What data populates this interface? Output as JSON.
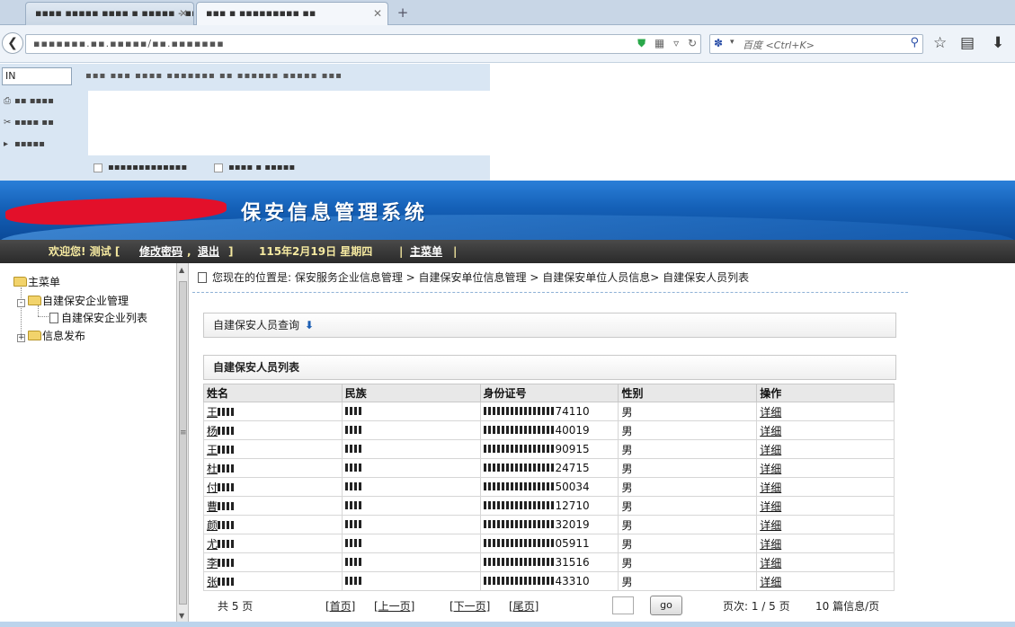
{
  "browser": {
    "tabs": [
      {
        "label": "▪▪▪▪ ▪▪▪▪▪ ▪▪▪▪ ▪ ▪▪▪▪▪ - ▪▪▪▪",
        "state": "inactive"
      },
      {
        "label": "▪▪▪ ▪ ▪▪▪▪▪▪▪▪▪ ▪▪",
        "state": "active"
      }
    ],
    "tab_close": "✕",
    "new_tab": "+",
    "url": "▪▪▪▪▪▪▪.▪▪.▪▪▪▪▪/▪▪.▪▪▪▪▪▪▪",
    "search_placeholder": "百度 <Ctrl+K>"
  },
  "extbar": {
    "input_value": "IN",
    "blur_text": "▪▪▪ ▪▪▪ ▪▪▪▪ ▪▪▪▪▪▪▪ ▪▪ ▪▪▪▪▪▪ ▪▪▪▪▪ ▪▪▪",
    "panel_items": [
      "▪▪ ▪▪▪▪",
      "▪▪▪▪ ▪▪",
      "▪▪▪▪▪"
    ],
    "check_items": [
      "▪▪▪▪▪▪▪▪▪▪▪▪▪",
      "▪▪▪▪ ▪ ▪▪▪▪▪"
    ]
  },
  "site": {
    "title": "保安信息管理系统",
    "welcome": "欢迎您! 测试 [",
    "change_pwd": "修改密码",
    "sep": ",",
    "logout": "退出",
    "close_bracket": "]",
    "date": "115年2月19日 星期四",
    "pipe": "|",
    "main_menu": "主菜单",
    "pipe2": "|"
  },
  "tree": {
    "root": "主菜单",
    "node1": "自建保安企业管理",
    "node1_child": "自建保安企业列表",
    "node2": "信息发布",
    "minus": "-",
    "plus": "+"
  },
  "content": {
    "breadcrumb": "您现在的位置是: 保安服务企业信息管理 > 自建保安单位信息管理 > 自建保安单位人员信息> 自建保安人员列表",
    "query_title": "自建保安人员查询",
    "query_arrow": "⬇",
    "list_title": "自建保安人员列表",
    "columns": [
      "姓名",
      "民族",
      "身份证号",
      "性别",
      "操作"
    ],
    "rows": [
      {
        "name": "王",
        "id_tail": "74110",
        "gender": "男",
        "action": "详细"
      },
      {
        "name": "杨",
        "id_tail": "40019",
        "gender": "男",
        "action": "详细"
      },
      {
        "name": "王",
        "id_tail": "90915",
        "gender": "男",
        "action": "详细"
      },
      {
        "name": "杜",
        "id_tail": "24715",
        "gender": "男",
        "action": "详细"
      },
      {
        "name": "付",
        "id_tail": "50034",
        "gender": "男",
        "action": "详细"
      },
      {
        "name": "曹",
        "id_tail": "12710",
        "gender": "男",
        "action": "详细"
      },
      {
        "name": "颜",
        "id_tail": "32019",
        "gender": "男",
        "action": "详细"
      },
      {
        "name": "尤",
        "id_tail": "05911",
        "gender": "男",
        "action": "详细"
      },
      {
        "name": "李",
        "id_tail": "31516",
        "gender": "男",
        "action": "详细"
      },
      {
        "name": "张",
        "id_tail": "43310",
        "gender": "男",
        "action": "详细"
      }
    ],
    "pager": {
      "total": "共  5  页",
      "first": "[首页]",
      "prev": "[上一页]",
      "next": "[下一页]",
      "last": "[尾页]",
      "go": "go",
      "page_info": "页次: 1 / 5 页",
      "per_page": "10  篇信息/页"
    }
  },
  "colors": {
    "banner": "#1561b8",
    "infobar": "#333333",
    "infobar_text": "#f5e9a0",
    "redact": "#e3102a"
  }
}
